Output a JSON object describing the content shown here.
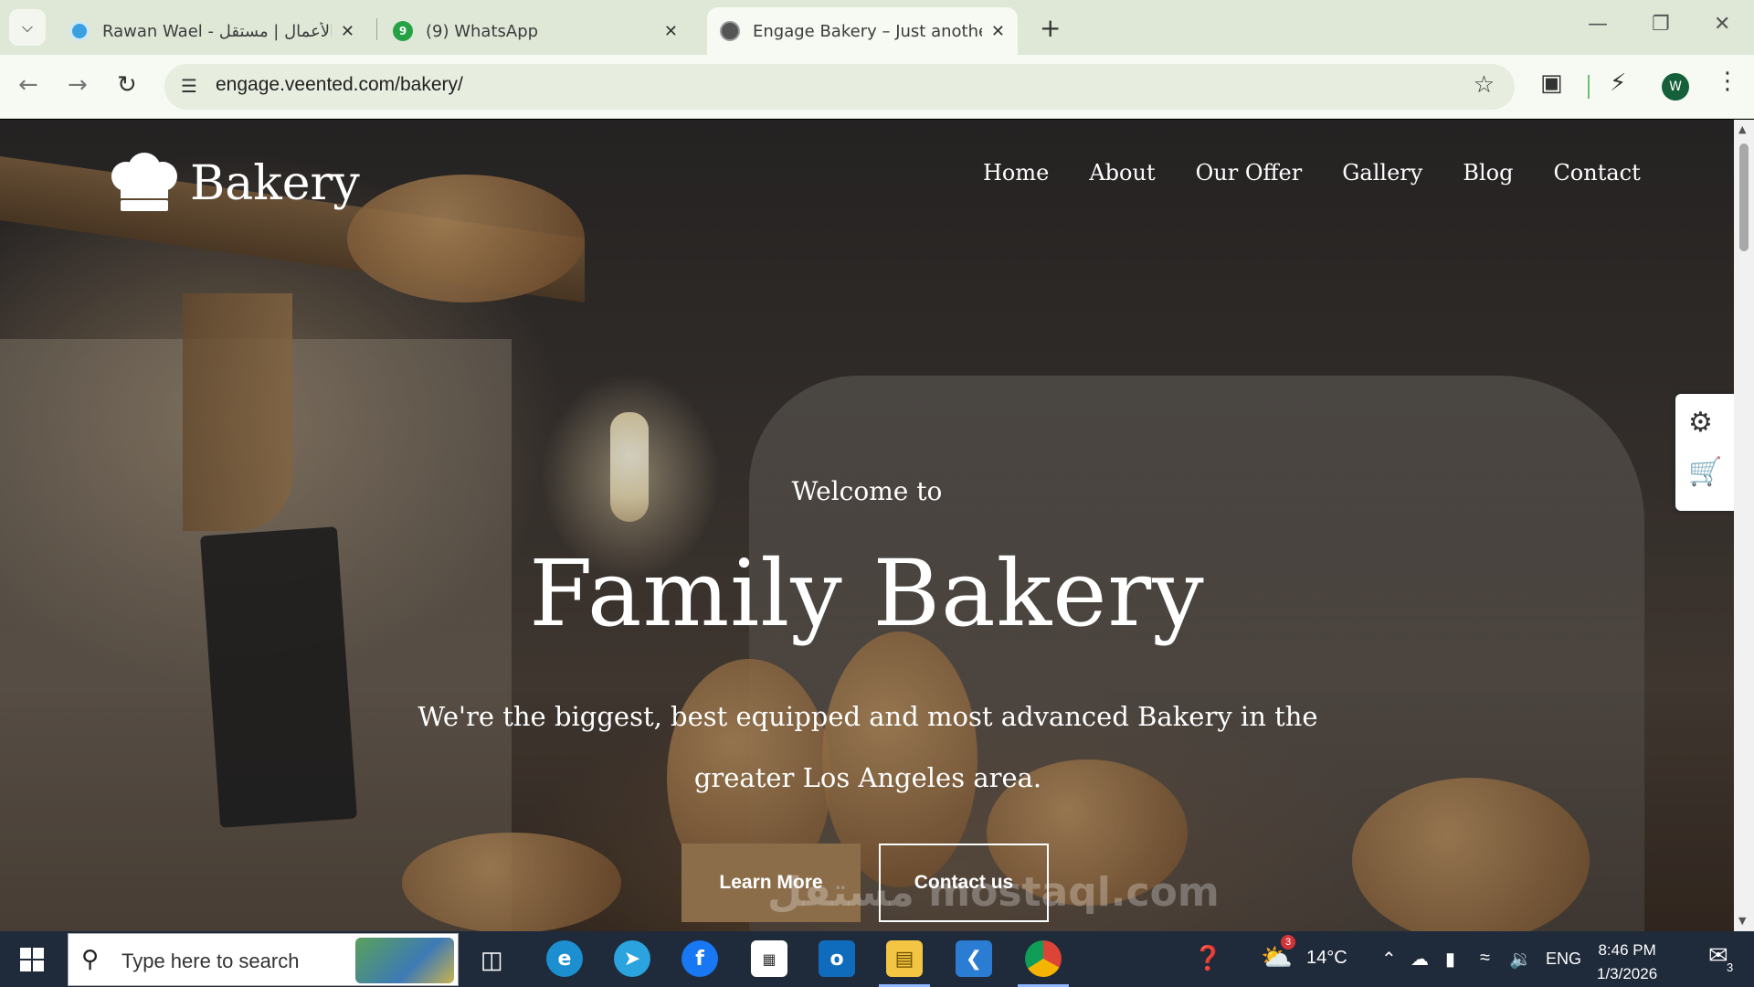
{
  "browser": {
    "tabs": [
      {
        "title": "Rawan Wael - الأعمال | مستقل",
        "favicon": "mostaql-icon",
        "active": false
      },
      {
        "title": "(9) WhatsApp",
        "favicon": "whatsapp-icon",
        "badge": "9",
        "active": false
      },
      {
        "title": "Engage Bakery – Just another E",
        "favicon": "globe-icon",
        "active": true
      }
    ],
    "url": "engage.veented.com/bakery/",
    "profile_initial": "W",
    "accent_color": "#15603a"
  },
  "site": {
    "logo_text": "Bakery",
    "nav": [
      {
        "label": "Home",
        "active": true
      },
      {
        "label": "About"
      },
      {
        "label": "Our Offer"
      },
      {
        "label": "Gallery"
      },
      {
        "label": "Blog"
      },
      {
        "label": "Contact"
      }
    ],
    "hero": {
      "welcome": "Welcome to",
      "title": "Family Bakery",
      "description": "We're the biggest, best equipped and most advanced Bakery in the greater Los Angeles area.",
      "primary_button": "Learn More",
      "secondary_button": "Contact us"
    },
    "side_widget": [
      "settings-gears-icon",
      "shopping-cart-icon"
    ],
    "watermark": "مستقل mostaql.com",
    "button_color": "#8b6d4a",
    "nav_active_color": "#c8a56e"
  },
  "taskbar": {
    "search_placeholder": "Type here to search",
    "weather": {
      "temp": "14°C",
      "alert_count": "3"
    },
    "language": "ENG",
    "time": "8:46 PM",
    "date": "1/3/2026",
    "notification_count": "3"
  }
}
